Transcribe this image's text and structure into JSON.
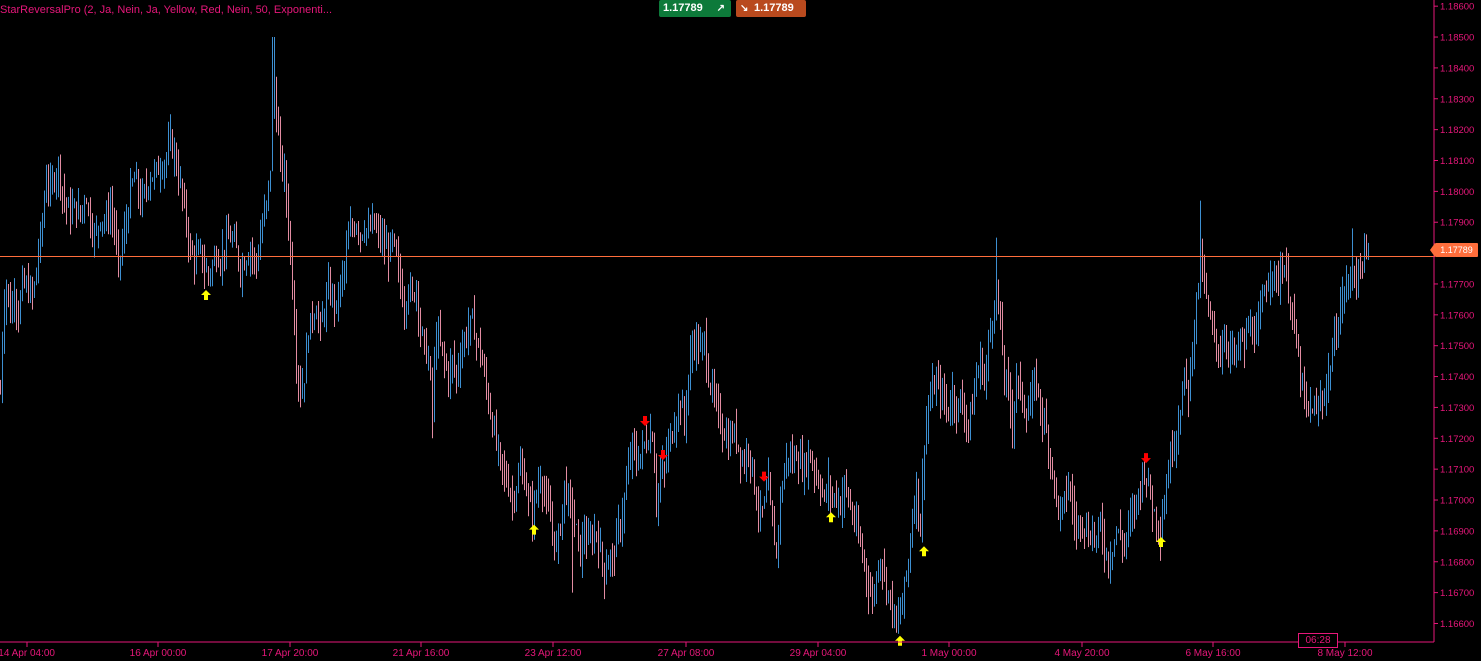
{
  "indicator": {
    "title": "StarReversalPro (2, Ja, Nein, Ja, Yellow, Red, Nein, 50, Exponenti..."
  },
  "quote": {
    "buy": "1.17789",
    "sell": "1.17789"
  },
  "current_price_label": "1.17789",
  "time_label": "06:28",
  "colors": {
    "background": "#000000",
    "axis": "#e6177a",
    "bull": "#3d8fd1",
    "bear": "#e28ca2",
    "price_line": "#ff6e3c",
    "buy_arrow": "#ffff00",
    "sell_arrow": "#ff0000"
  },
  "chart_data": {
    "type": "ohlc",
    "ylim": [
      1.1654,
      1.1862
    ],
    "y_ticks": [
      "1.18600",
      "1.18500",
      "1.18400",
      "1.18300",
      "1.18200",
      "1.18100",
      "1.18000",
      "1.17900",
      "1.17700",
      "1.17600",
      "1.17500",
      "1.17400",
      "1.17300",
      "1.17200",
      "1.17100",
      "1.17000",
      "1.16900",
      "1.16800",
      "1.16700",
      "1.16600"
    ],
    "x_ticks": [
      "14 Apr 04:00",
      "16 Apr 00:00",
      "17 Apr 20:00",
      "21 Apr 16:00",
      "23 Apr 12:00",
      "27 Apr 08:00",
      "29 Apr 04:00",
      "1 May 00:00",
      "4 May 20:00",
      "6 May 16:00",
      "8 May 12:00"
    ],
    "current_price": 1.17789,
    "close_path": [
      [
        0,
        1.1735
      ],
      [
        3,
        1.1762
      ],
      [
        6,
        1.177
      ],
      [
        10,
        1.176
      ],
      [
        14,
        1.1768
      ],
      [
        18,
        1.176
      ],
      [
        22,
        1.177
      ],
      [
        28,
        1.1768
      ],
      [
        33,
        1.1766
      ],
      [
        37,
        1.1778
      ],
      [
        42,
        1.179
      ],
      [
        46,
        1.1805
      ],
      [
        50,
        1.18
      ],
      [
        54,
        1.1805
      ],
      [
        58,
        1.1808
      ],
      [
        62,
        1.18
      ],
      [
        66,
        1.1795
      ],
      [
        70,
        1.1793
      ],
      [
        75,
        1.1795
      ],
      [
        80,
        1.1792
      ],
      [
        85,
        1.18
      ],
      [
        90,
        1.179
      ],
      [
        95,
        1.1785
      ],
      [
        100,
        1.1792
      ],
      [
        105,
        1.179
      ],
      [
        110,
        1.1795
      ],
      [
        114,
        1.1788
      ],
      [
        118,
        1.1775
      ],
      [
        122,
        1.1783
      ],
      [
        126,
        1.179
      ],
      [
        130,
        1.18
      ],
      [
        135,
        1.1805
      ],
      [
        140,
        1.1796
      ],
      [
        145,
        1.18
      ],
      [
        150,
        1.1805
      ],
      [
        155,
        1.1806
      ],
      [
        160,
        1.1808
      ],
      [
        165,
        1.181
      ],
      [
        170,
        1.1816
      ],
      [
        174,
        1.1812
      ],
      [
        178,
        1.1805
      ],
      [
        182,
        1.1798
      ],
      [
        186,
        1.179
      ],
      [
        190,
        1.178
      ],
      [
        195,
        1.1778
      ],
      [
        200,
        1.178
      ],
      [
        204,
        1.1775
      ],
      [
        208,
        1.1773
      ],
      [
        212,
        1.1776
      ],
      [
        216,
        1.178
      ],
      [
        220,
        1.1778
      ],
      [
        225,
        1.1783
      ],
      [
        230,
        1.1785
      ],
      [
        235,
        1.1782
      ],
      [
        240,
        1.1775
      ],
      [
        245,
        1.1778
      ],
      [
        250,
        1.1782
      ],
      [
        255,
        1.1776
      ],
      [
        258,
        1.178
      ],
      [
        262,
        1.179
      ],
      [
        266,
        1.1795
      ],
      [
        270,
        1.1808
      ],
      [
        273,
        1.1835
      ],
      [
        276,
        1.1825
      ],
      [
        280,
        1.181
      ],
      [
        284,
        1.1805
      ],
      [
        288,
        1.179
      ],
      [
        292,
        1.177
      ],
      [
        296,
        1.1745
      ],
      [
        300,
        1.1735
      ],
      [
        304,
        1.174
      ],
      [
        308,
        1.1755
      ],
      [
        312,
        1.176
      ],
      [
        316,
        1.1762
      ],
      [
        320,
        1.1755
      ],
      [
        324,
        1.1762
      ],
      [
        328,
        1.1768
      ],
      [
        332,
        1.1766
      ],
      [
        336,
        1.1762
      ],
      [
        340,
        1.177
      ],
      [
        344,
        1.1775
      ],
      [
        348,
        1.1785
      ],
      [
        352,
        1.1788
      ],
      [
        356,
        1.179
      ],
      [
        360,
        1.1786
      ],
      [
        364,
        1.1789
      ],
      [
        368,
        1.1786
      ],
      [
        372,
        1.179
      ],
      [
        376,
        1.1787
      ],
      [
        380,
        1.1785
      ],
      [
        384,
        1.1782
      ],
      [
        388,
        1.178
      ],
      [
        392,
        1.1784
      ],
      [
        396,
        1.1778
      ],
      [
        400,
        1.177
      ],
      [
        404,
        1.1762
      ],
      [
        408,
        1.177
      ],
      [
        412,
        1.1765
      ],
      [
        416,
        1.177
      ],
      [
        420,
        1.1755
      ],
      [
        424,
        1.175
      ],
      [
        428,
        1.1745
      ],
      [
        432,
        1.173
      ],
      [
        436,
        1.1755
      ],
      [
        440,
        1.175
      ],
      [
        444,
        1.1745
      ],
      [
        448,
        1.174
      ],
      [
        452,
        1.1745
      ],
      [
        456,
        1.174
      ],
      [
        460,
        1.1748
      ],
      [
        464,
        1.1752
      ],
      [
        468,
        1.1756
      ],
      [
        472,
        1.1758
      ],
      [
        476,
        1.1752
      ],
      [
        480,
        1.1748
      ],
      [
        484,
        1.174
      ],
      [
        488,
        1.1732
      ],
      [
        492,
        1.1725
      ],
      [
        496,
        1.1718
      ],
      [
        500,
        1.1712
      ],
      [
        504,
        1.1708
      ],
      [
        508,
        1.1705
      ],
      [
        512,
        1.17
      ],
      [
        516,
        1.1705
      ],
      [
        520,
        1.171
      ],
      [
        524,
        1.1707
      ],
      [
        528,
        1.17
      ],
      [
        532,
        1.1695
      ],
      [
        536,
        1.1702
      ],
      [
        540,
        1.1708
      ],
      [
        544,
        1.1702
      ],
      [
        548,
        1.1696
      ],
      [
        552,
        1.169
      ],
      [
        556,
        1.1684
      ],
      [
        560,
        1.1692
      ],
      [
        564,
        1.1705
      ],
      [
        568,
        1.17
      ],
      [
        572,
        1.1695
      ],
      [
        576,
        1.169
      ],
      [
        580,
        1.1682
      ],
      [
        584,
        1.169
      ],
      [
        588,
        1.1685
      ],
      [
        592,
        1.1688
      ],
      [
        596,
        1.169
      ],
      [
        600,
        1.1683
      ],
      [
        604,
        1.1676
      ],
      [
        608,
        1.1682
      ],
      [
        612,
        1.168
      ],
      [
        616,
        1.1688
      ],
      [
        620,
        1.1692
      ],
      [
        624,
        1.17
      ],
      [
        628,
        1.171
      ],
      [
        632,
        1.1718
      ],
      [
        636,
        1.1712
      ],
      [
        640,
        1.1715
      ],
      [
        644,
        1.1718
      ],
      [
        648,
        1.172
      ],
      [
        652,
        1.1722
      ],
      [
        656,
        1.17
      ],
      [
        660,
        1.1708
      ],
      [
        664,
        1.171
      ],
      [
        668,
        1.1718
      ],
      [
        672,
        1.1722
      ],
      [
        676,
        1.1728
      ],
      [
        680,
        1.1732
      ],
      [
        684,
        1.1725
      ],
      [
        688,
        1.174
      ],
      [
        692,
        1.175
      ],
      [
        696,
        1.1752
      ],
      [
        700,
        1.1748
      ],
      [
        704,
        1.1752
      ],
      [
        708,
        1.174
      ],
      [
        712,
        1.1735
      ],
      [
        716,
        1.173
      ],
      [
        720,
        1.1725
      ],
      [
        724,
        1.1722
      ],
      [
        728,
        1.1718
      ],
      [
        732,
        1.1722
      ],
      [
        736,
        1.172
      ],
      [
        740,
        1.1715
      ],
      [
        744,
        1.1712
      ],
      [
        748,
        1.1718
      ],
      [
        752,
        1.171
      ],
      [
        756,
        1.17
      ],
      [
        760,
        1.1695
      ],
      [
        764,
        1.1698
      ],
      [
        768,
        1.1705
      ],
      [
        772,
        1.169
      ],
      [
        776,
        1.1684
      ],
      [
        780,
        1.17
      ],
      [
        784,
        1.171
      ],
      [
        788,
        1.1715
      ],
      [
        792,
        1.1712
      ],
      [
        796,
        1.1715
      ],
      [
        800,
        1.1712
      ],
      [
        804,
        1.171
      ],
      [
        808,
        1.1715
      ],
      [
        812,
        1.1712
      ],
      [
        816,
        1.1708
      ],
      [
        820,
        1.1705
      ],
      [
        824,
        1.17
      ],
      [
        828,
        1.1705
      ],
      [
        832,
        1.17
      ],
      [
        836,
        1.1702
      ],
      [
        840,
        1.1698
      ],
      [
        844,
        1.1705
      ],
      [
        848,
        1.17
      ],
      [
        852,
        1.1695
      ],
      [
        856,
        1.169
      ],
      [
        860,
        1.1685
      ],
      [
        864,
        1.168
      ],
      [
        868,
        1.1672
      ],
      [
        872,
        1.1668
      ],
      [
        876,
        1.1675
      ],
      [
        880,
        1.1682
      ],
      [
        884,
        1.1676
      ],
      [
        888,
        1.167
      ],
      [
        892,
        1.1665
      ],
      [
        896,
        1.166
      ],
      [
        900,
        1.1663
      ],
      [
        904,
        1.1672
      ],
      [
        908,
        1.168
      ],
      [
        912,
        1.1695
      ],
      [
        916,
        1.1705
      ],
      [
        920,
        1.169
      ],
      [
        924,
        1.172
      ],
      [
        928,
        1.173
      ],
      [
        932,
        1.1735
      ],
      [
        936,
        1.1738
      ],
      [
        940,
        1.1735
      ],
      [
        944,
        1.1732
      ],
      [
        948,
        1.1728
      ],
      [
        952,
        1.1735
      ],
      [
        956,
        1.173
      ],
      [
        960,
        1.1732
      ],
      [
        964,
        1.1728
      ],
      [
        968,
        1.1725
      ],
      [
        972,
        1.173
      ],
      [
        976,
        1.174
      ],
      [
        980,
        1.1745
      ],
      [
        984,
        1.1738
      ],
      [
        988,
        1.175
      ],
      [
        992,
        1.176
      ],
      [
        996,
        1.177
      ],
      [
        1000,
        1.1755
      ],
      [
        1004,
        1.174
      ],
      [
        1008,
        1.1735
      ],
      [
        1012,
        1.1725
      ],
      [
        1016,
        1.174
      ],
      [
        1020,
        1.1735
      ],
      [
        1024,
        1.173
      ],
      [
        1028,
        1.1728
      ],
      [
        1032,
        1.1735
      ],
      [
        1036,
        1.1738
      ],
      [
        1040,
        1.173
      ],
      [
        1044,
        1.1725
      ],
      [
        1048,
        1.1718
      ],
      [
        1052,
        1.171
      ],
      [
        1056,
        1.17
      ],
      [
        1060,
        1.1695
      ],
      [
        1064,
        1.17
      ],
      [
        1068,
        1.1705
      ],
      [
        1072,
        1.1698
      ],
      [
        1076,
        1.169
      ],
      [
        1080,
        1.1695
      ],
      [
        1084,
        1.1692
      ],
      [
        1088,
        1.1688
      ],
      [
        1092,
        1.169
      ],
      [
        1096,
        1.1687
      ],
      [
        1100,
        1.1692
      ],
      [
        1104,
        1.1685
      ],
      [
        1108,
        1.168
      ],
      [
        1112,
        1.1685
      ],
      [
        1116,
        1.169
      ],
      [
        1120,
        1.1688
      ],
      [
        1124,
        1.1685
      ],
      [
        1128,
        1.1692
      ],
      [
        1132,
        1.1695
      ],
      [
        1136,
        1.17
      ],
      [
        1140,
        1.1705
      ],
      [
        1144,
        1.171
      ],
      [
        1148,
        1.1705
      ],
      [
        1152,
        1.1698
      ],
      [
        1156,
        1.1694
      ],
      [
        1160,
        1.169
      ],
      [
        1164,
        1.17
      ],
      [
        1168,
        1.171
      ],
      [
        1172,
        1.1718
      ],
      [
        1176,
        1.1722
      ],
      [
        1180,
        1.173
      ],
      [
        1184,
        1.174
      ],
      [
        1188,
        1.1735
      ],
      [
        1192,
        1.175
      ],
      [
        1196,
        1.1765
      ],
      [
        1200,
        1.1778
      ],
      [
        1204,
        1.177
      ],
      [
        1208,
        1.176
      ],
      [
        1212,
        1.1755
      ],
      [
        1216,
        1.175
      ],
      [
        1220,
        1.1748
      ],
      [
        1224,
        1.1752
      ],
      [
        1228,
        1.175
      ],
      [
        1232,
        1.1748
      ],
      [
        1236,
        1.1746
      ],
      [
        1240,
        1.1752
      ],
      [
        1244,
        1.175
      ],
      [
        1248,
        1.1756
      ],
      [
        1252,
        1.1755
      ],
      [
        1256,
        1.1752
      ],
      [
        1260,
        1.176
      ],
      [
        1264,
        1.1768
      ],
      [
        1268,
        1.1772
      ],
      [
        1272,
        1.1776
      ],
      [
        1276,
        1.177
      ],
      [
        1280,
        1.1774
      ],
      [
        1284,
        1.1776
      ],
      [
        1288,
        1.1768
      ],
      [
        1292,
        1.176
      ],
      [
        1296,
        1.175
      ],
      [
        1300,
        1.174
      ],
      [
        1304,
        1.1732
      ],
      [
        1308,
        1.1728
      ],
      [
        1312,
        1.173
      ],
      [
        1316,
        1.1728
      ],
      [
        1320,
        1.1732
      ],
      [
        1324,
        1.1735
      ],
      [
        1328,
        1.174
      ],
      [
        1332,
        1.1748
      ],
      [
        1336,
        1.1755
      ],
      [
        1340,
        1.1762
      ],
      [
        1344,
        1.1768
      ],
      [
        1348,
        1.177
      ],
      [
        1352,
        1.1775
      ],
      [
        1356,
        1.1772
      ],
      [
        1360,
        1.1776
      ],
      [
        1364,
        1.1778
      ],
      [
        1368,
        1.1779
      ]
    ],
    "spikes": [
      {
        "x": 170,
        "high": 1.1825
      },
      {
        "x": 273,
        "high": 1.185
      },
      {
        "x": 996,
        "high": 1.1785
      },
      {
        "x": 1200,
        "high": 1.1797
      },
      {
        "x": 1352,
        "high": 1.1788
      },
      {
        "x": 572,
        "low": 1.167
      },
      {
        "x": 896,
        "low": 1.1657
      },
      {
        "x": 300,
        "low": 1.173
      },
      {
        "x": 432,
        "low": 1.172
      }
    ],
    "buy_signals": [
      {
        "x": 206,
        "price": 1.1769
      },
      {
        "x": 534,
        "price": 1.1693
      },
      {
        "x": 831,
        "price": 1.1697
      },
      {
        "x": 900,
        "price": 1.1657
      },
      {
        "x": 924,
        "price": 1.1686
      },
      {
        "x": 1161,
        "price": 1.1689
      }
    ],
    "sell_signals": [
      {
        "x": 645,
        "price": 1.1723
      },
      {
        "x": 663,
        "price": 1.1712
      },
      {
        "x": 764,
        "price": 1.1705
      },
      {
        "x": 1146,
        "price": 1.1711
      }
    ]
  }
}
